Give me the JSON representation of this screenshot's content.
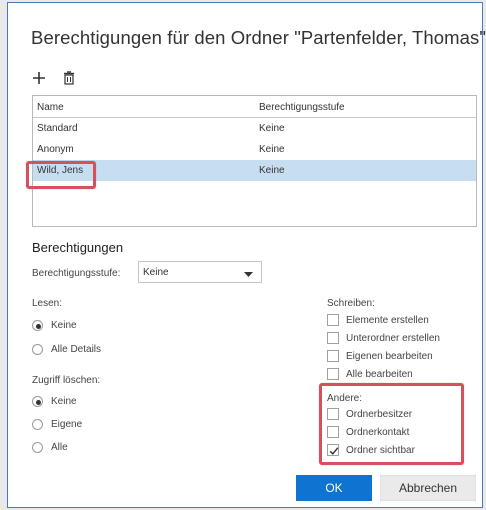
{
  "dialog": {
    "title": "Berechtigungen für den Ordner \"Partenfelder, Thomas\""
  },
  "toolbar": {
    "add_icon": "plus-icon",
    "delete_icon": "trash-icon"
  },
  "grid": {
    "columns": [
      "Name",
      "Berechtigungsstufe"
    ],
    "rows": [
      {
        "name": "Standard",
        "level": "Keine",
        "selected": false
      },
      {
        "name": "Anonym",
        "level": "Keine",
        "selected": false
      },
      {
        "name": "Wild, Jens",
        "level": "Keine",
        "selected": true
      }
    ]
  },
  "permissions": {
    "section_title": "Berechtigungen",
    "level_label": "Berechtigungsstufe:",
    "level_value": "Keine",
    "read": {
      "label": "Lesen:",
      "options": [
        "Keine",
        "Alle Details"
      ],
      "selected": "Keine"
    },
    "delete": {
      "label": "Zugriff löschen:",
      "options": [
        "Keine",
        "Eigene",
        "Alle"
      ],
      "selected": "Keine"
    },
    "write": {
      "label": "Schreiben:",
      "options": [
        {
          "label": "Elemente erstellen",
          "checked": false
        },
        {
          "label": "Unterordner erstellen",
          "checked": false
        },
        {
          "label": "Eigenen bearbeiten",
          "checked": false
        },
        {
          "label": "Alle bearbeiten",
          "checked": false
        }
      ]
    },
    "other": {
      "label": "Andere:",
      "options": [
        {
          "label": "Ordnerbesitzer",
          "checked": false
        },
        {
          "label": "Ordnerkontakt",
          "checked": false
        },
        {
          "label": "Ordner sichtbar",
          "checked": true
        }
      ]
    }
  },
  "buttons": {
    "ok": "OK",
    "cancel": "Abbrechen"
  },
  "colors": {
    "accent": "#0f74d1",
    "selection": "#c7def1",
    "highlight": "#d6505d",
    "dialog_border": "#4a78b8"
  }
}
